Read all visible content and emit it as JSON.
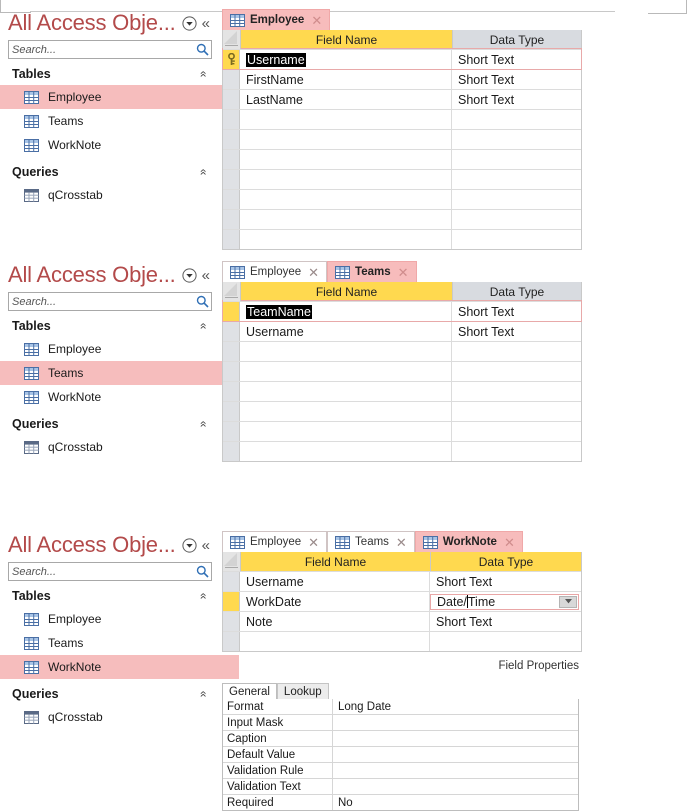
{
  "app": {
    "nav_title": "All Access Obje...",
    "search_placeholder": "Search...",
    "groups": {
      "tables": "Tables",
      "queries": "Queries"
    },
    "objects": {
      "employee": "Employee",
      "teams": "Teams",
      "worknote": "WorkNote",
      "qcrosstab": "qCrosstab"
    },
    "icons": {
      "dropdown": "chevron-down-circle-icon",
      "collapse": "double-chevron-left-icon",
      "search": "search-icon",
      "group_chevron": "double-chevron-up-icon",
      "table": "table-icon",
      "query": "query-icon",
      "close_tab": "close-icon",
      "primary_key": "key-icon",
      "combo_arrow": "chevron-down-icon"
    },
    "colors": {
      "accent": "#b34a4a",
      "selected_row": "#f6bdbd",
      "active_tab": "#f7bcbc",
      "field_name_header": "#ffd94f",
      "data_type_header": "#d8dbe0"
    }
  },
  "columns": {
    "field_name": "Field Name",
    "data_type": "Data Type"
  },
  "field_properties_label": "Field Properties",
  "panels": [
    {
      "id": "panel-employee",
      "selected_object": "Employee",
      "tabs": [
        {
          "label": "Employee",
          "active": true
        }
      ],
      "data_type_header_highlighted": false,
      "rows": [
        {
          "field": "Username",
          "type": "Short Text",
          "pk": true,
          "selected": true,
          "editing": true
        },
        {
          "field": "FirstName",
          "type": "Short Text",
          "pk": false,
          "selected": false,
          "editing": false
        },
        {
          "field": "LastName",
          "type": "Short Text",
          "pk": false,
          "selected": false,
          "editing": false
        }
      ],
      "empty_rows": 7
    },
    {
      "id": "panel-teams",
      "selected_object": "Teams",
      "tabs": [
        {
          "label": "Employee",
          "active": false
        },
        {
          "label": "Teams",
          "active": true
        }
      ],
      "data_type_header_highlighted": false,
      "rows": [
        {
          "field": "TeamName",
          "type": "Short Text",
          "pk": false,
          "selected": true,
          "editing": true,
          "current": true
        },
        {
          "field": "Username",
          "type": "Short Text",
          "pk": false,
          "selected": false,
          "editing": false
        }
      ],
      "empty_rows": 6
    },
    {
      "id": "panel-worknote",
      "selected_object": "WorkNote",
      "tabs": [
        {
          "label": "Employee",
          "active": false
        },
        {
          "label": "Teams",
          "active": false
        },
        {
          "label": "WorkNote",
          "active": true
        }
      ],
      "data_type_header_highlighted": true,
      "rows": [
        {
          "field": "Username",
          "type": "Short Text",
          "pk": false,
          "selected": false,
          "editing": false
        },
        {
          "field": "WorkDate",
          "type": "Date/Time",
          "pk": false,
          "selected": false,
          "editing": false,
          "current": true,
          "combo": true
        },
        {
          "field": "Note",
          "type": "Short Text",
          "pk": false,
          "selected": false,
          "editing": false
        }
      ],
      "empty_rows": 1,
      "field_properties": {
        "tabs": [
          {
            "label": "General",
            "active": true
          },
          {
            "label": "Lookup",
            "active": false
          }
        ],
        "rows": [
          {
            "key": "Format",
            "value": "Long Date"
          },
          {
            "key": "Input Mask",
            "value": ""
          },
          {
            "key": "Caption",
            "value": ""
          },
          {
            "key": "Default Value",
            "value": ""
          },
          {
            "key": "Validation Rule",
            "value": ""
          },
          {
            "key": "Validation Text",
            "value": ""
          },
          {
            "key": "Required",
            "value": "No"
          }
        ]
      }
    }
  ]
}
